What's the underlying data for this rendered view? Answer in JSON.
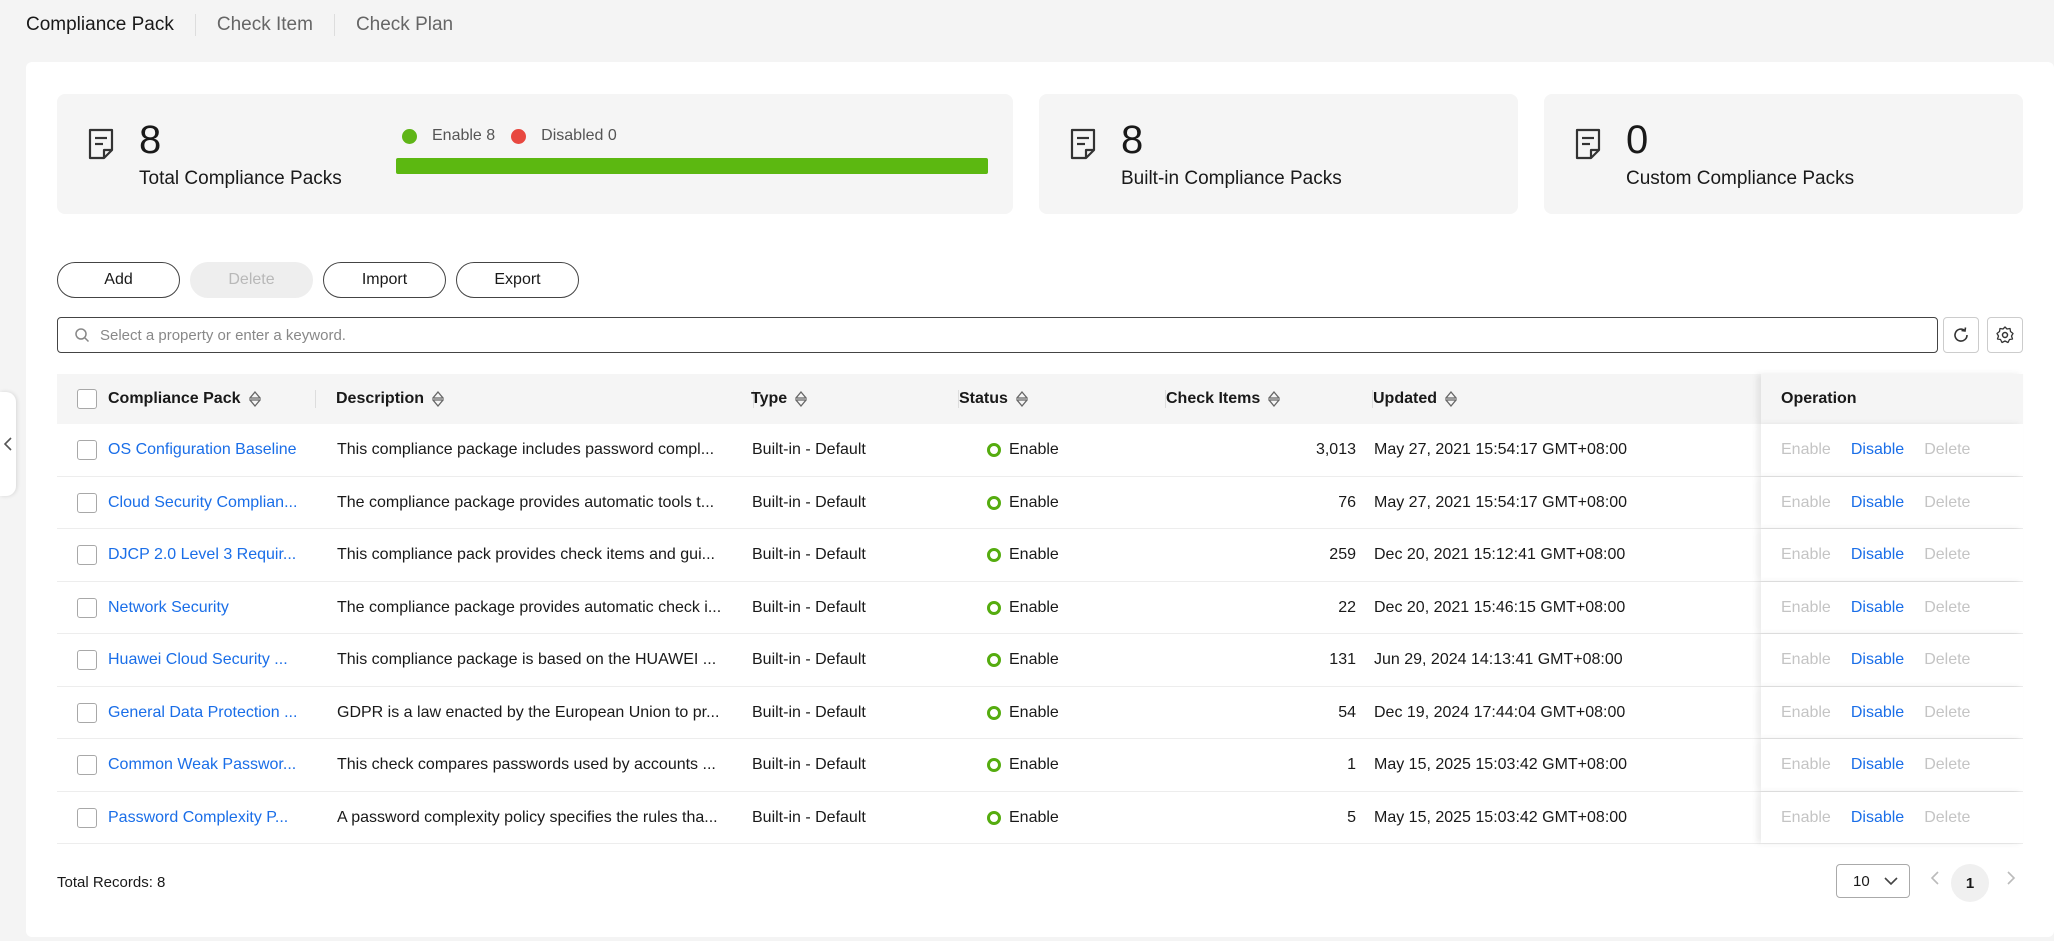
{
  "tabs": [
    "Compliance Pack",
    "Check Item",
    "Check Plan"
  ],
  "summary": {
    "total": {
      "value": "8",
      "label": "Total Compliance Packs",
      "enable_label": "Enable 8",
      "disabled_label": "Disabled 0",
      "enabled_fraction": 1.0
    },
    "builtin": {
      "value": "8",
      "label": "Built-in Compliance Packs"
    },
    "custom": {
      "value": "0",
      "label": "Custom Compliance Packs"
    }
  },
  "toolbar": {
    "add": "Add",
    "delete": "Delete",
    "import": "Import",
    "export": "Export"
  },
  "search": {
    "placeholder": "Select a property or enter a keyword."
  },
  "table": {
    "headers": [
      "Compliance Pack",
      "Description",
      "Type",
      "Status",
      "Check Items",
      "Updated",
      "Operation"
    ],
    "rows": [
      {
        "name": "OS Configuration Baseline",
        "desc": "This compliance package includes password compl...",
        "type": "Built-in - Default",
        "status": "Enable",
        "items": "3,013",
        "updated": "May 27, 2021 15:54:17 GMT+08:00"
      },
      {
        "name": "Cloud Security Complian...",
        "desc": "The compliance package provides automatic tools t...",
        "type": "Built-in - Default",
        "status": "Enable",
        "items": "76",
        "updated": "May 27, 2021 15:54:17 GMT+08:00"
      },
      {
        "name": "DJCP 2.0 Level 3 Requir...",
        "desc": "This compliance pack provides check items and gui...",
        "type": "Built-in - Default",
        "status": "Enable",
        "items": "259",
        "updated": "Dec 20, 2021 15:12:41 GMT+08:00"
      },
      {
        "name": "Network Security",
        "desc": "The compliance package provides automatic check i...",
        "type": "Built-in - Default",
        "status": "Enable",
        "items": "22",
        "updated": "Dec 20, 2021 15:46:15 GMT+08:00"
      },
      {
        "name": "Huawei Cloud Security ...",
        "desc": "This compliance package is based on the HUAWEI ...",
        "type": "Built-in - Default",
        "status": "Enable",
        "items": "131",
        "updated": "Jun 29, 2024 14:13:41 GMT+08:00"
      },
      {
        "name": "General Data Protection ...",
        "desc": "GDPR is a law enacted by the European Union to pr...",
        "type": "Built-in - Default",
        "status": "Enable",
        "items": "54",
        "updated": "Dec 19, 2024 17:44:04 GMT+08:00"
      },
      {
        "name": "Common Weak Passwor...",
        "desc": "This check compares passwords used by accounts ...",
        "type": "Built-in - Default",
        "status": "Enable",
        "items": "1",
        "updated": "May 15, 2025 15:03:42 GMT+08:00"
      },
      {
        "name": "Password Complexity P...",
        "desc": "A password complexity policy specifies the rules tha...",
        "type": "Built-in - Default",
        "status": "Enable",
        "items": "5",
        "updated": "May 15, 2025 15:03:42 GMT+08:00"
      }
    ],
    "ops": [
      "Enable",
      "Disable",
      "Delete"
    ]
  },
  "footer": {
    "total": "Total Records: 8",
    "page_size": "10",
    "current_page": "1"
  },
  "colors": {
    "accent": "#1a6ee8",
    "enabled": "#5cb811",
    "disabled": "#e84840"
  }
}
